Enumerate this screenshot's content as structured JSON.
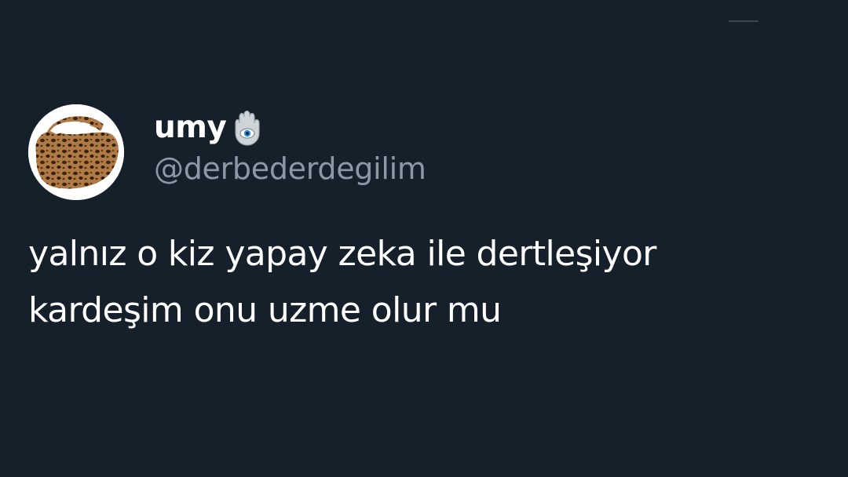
{
  "user": {
    "display_name": "umy",
    "handle": "@derbederdegilim",
    "name_emoji_icon": "hamsa-icon",
    "avatar_icon": "leopard-handbag-avatar"
  },
  "tweet": {
    "lines": [
      "yalnız o kiz yapay zeka ile dertleşiyor",
      "kardeşim onu uzme olur mu"
    ]
  },
  "colors": {
    "background": "#15202b",
    "text_primary": "#ffffff",
    "text_secondary": "#8b98a5"
  }
}
